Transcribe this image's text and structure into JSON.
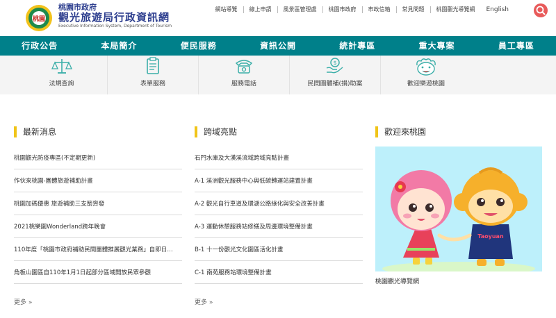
{
  "header": {
    "logo_badge": "桃園",
    "logo_line1": "桃園市政府",
    "logo_line2": "觀光旅遊局行政資訊網",
    "logo_line3": "Executive Information System, Department of Tourism",
    "top_links": [
      "網站導覽",
      "線上申請",
      "風景區管理處",
      "桃園市政府",
      "市政信箱",
      "常見問題",
      "桃園觀光導覽網"
    ],
    "english_label": "English"
  },
  "nav": {
    "items": [
      "行政公告",
      "本局簡介",
      "便民服務",
      "資訊公開",
      "統計專區",
      "重大專案",
      "員工專區"
    ]
  },
  "services": [
    {
      "label": "法規查詢",
      "icon": "scales-icon"
    },
    {
      "label": "表單服務",
      "icon": "form-icon"
    },
    {
      "label": "服務電話",
      "icon": "phone-icon"
    },
    {
      "label": "民間團體補(捐)助案",
      "icon": "donation-icon"
    },
    {
      "label": "歡迎樂遊桃園",
      "icon": "mascot-face-icon"
    }
  ],
  "news": {
    "title": "最新消息",
    "items": [
      "桃園觀光防疫專區(不定期更新)",
      "作伙來桃園-團體旅遊補助計畫",
      "桃園加碼優惠 旅遊補助三支箭齊發",
      "2021桃樂園Wonderland跨年晚會",
      "110年度「桃園市政府補助民間團體推展觀光業務」自即日…",
      "角板山園區自110年1月1日起部分區域開放民眾參觀"
    ],
    "more": "更多"
  },
  "highlights": {
    "title": "跨域亮點",
    "items": [
      "石門水庫及大漢溪流域跨域亮點計畫",
      "A-1 溪洲觀光服務中心與低碳轉運站建置計畫",
      "A-2 觀光自行車道及環湖公路綠化與安全改善計畫",
      "A-3 運動休憩服務站修繕及周邊環境整備計畫",
      "B-1 十一份觀光文化園區活化計畫",
      "C-1 南苑服務站環境整備計畫"
    ],
    "more": "更多"
  },
  "welcome": {
    "title": "歡迎來桃園",
    "caption": "桃園觀光導覽網",
    "mascot_jersey_text": "Taoyuan"
  },
  "colors": {
    "nav_bg": "#00808a",
    "accent_bar": "#f0c419",
    "search_btn": "#e85a5a",
    "icon_teal": "#3aaea8",
    "sky": "#bdf0fb"
  }
}
